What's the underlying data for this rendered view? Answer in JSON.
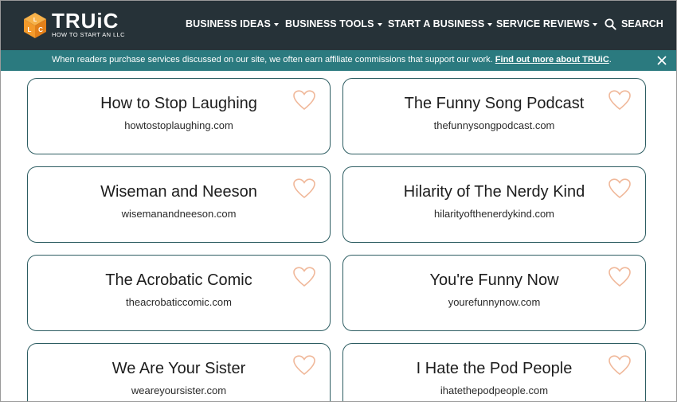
{
  "header": {
    "logo_word": "TRUiC",
    "logo_sub": "HOW TO START AN LLC",
    "logo_cube_letters": [
      "L",
      "L",
      "C"
    ],
    "nav": [
      {
        "label": "BUSINESS IDEAS"
      },
      {
        "label": "BUSINESS TOOLS"
      },
      {
        "label": "START A BUSINESS"
      },
      {
        "label": "SERVICE REVIEWS"
      }
    ],
    "search_label": "SEARCH",
    "search_icon": "search-icon"
  },
  "banner": {
    "message": "When readers purchase services discussed on our site, we often earn affiliate commissions that support our work.",
    "link_text": "Find out more about TRUiC",
    "link_suffix": ".",
    "close_icon": "close-icon"
  },
  "cards": [
    {
      "name": "How to Stop Laughing",
      "domain": "howtostoplaughing.com"
    },
    {
      "name": "The Funny Song Podcast",
      "domain": "thefunnysongpodcast.com"
    },
    {
      "name": "Wiseman and Neeson",
      "domain": "wisemanandneeson.com"
    },
    {
      "name": "Hilarity of The Nerdy Kind",
      "domain": "hilarityofthenerdykind.com"
    },
    {
      "name": "The Acrobatic Comic",
      "domain": "theacrobaticcomic.com"
    },
    {
      "name": "You're Funny Now",
      "domain": "yourefunnynow.com"
    },
    {
      "name": "We Are Your Sister",
      "domain": "weareyoursister.com"
    },
    {
      "name": "I Hate the Pod People",
      "domain": "ihatethepodpeople.com"
    }
  ],
  "colors": {
    "header_bg": "#263238",
    "banner_bg": "#2b7a7f",
    "card_border": "#2d5d62",
    "heart": "#f0b89a",
    "logo_orange": "#f39a2b"
  }
}
